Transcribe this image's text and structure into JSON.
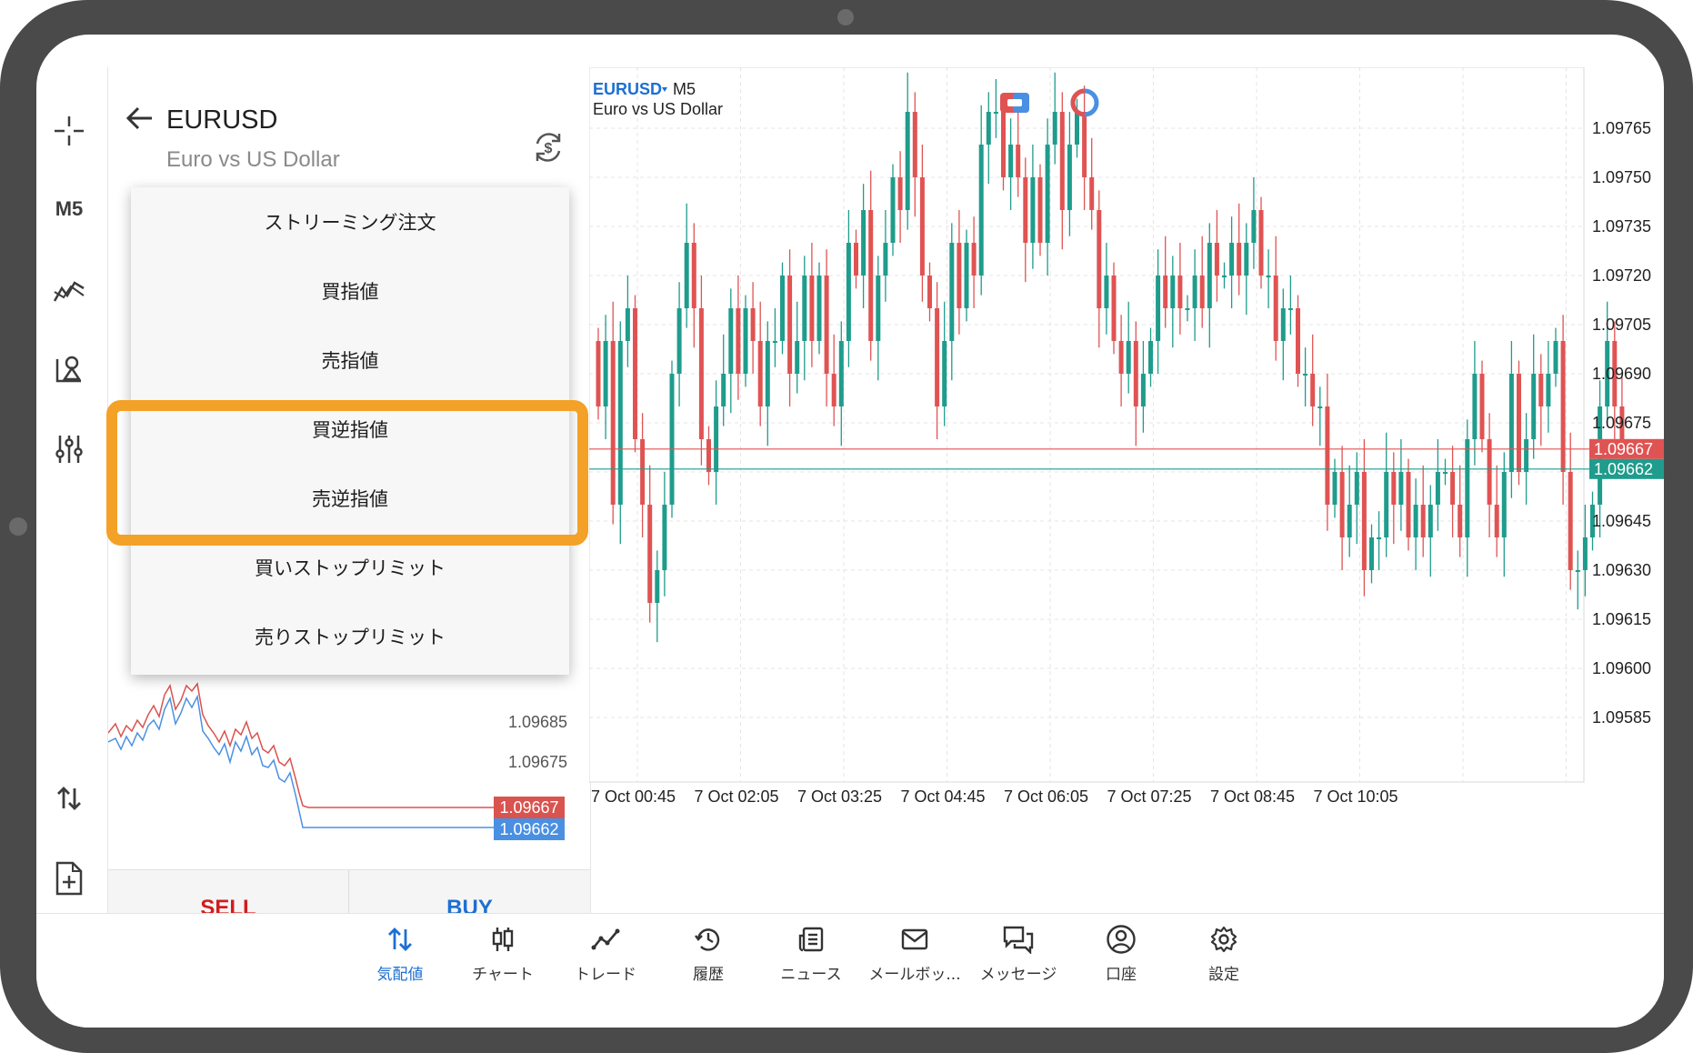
{
  "quote": {
    "symbol": "EURUSD",
    "description": "Euro vs US Dollar"
  },
  "leftbar": {
    "timeframe": "M5"
  },
  "order_menu": {
    "items": [
      "ストリーミング注文",
      "買指値",
      "売指値",
      "買逆指値",
      "売逆指値",
      "買いストップリミット",
      "売りストップリミット"
    ]
  },
  "mini_chart": {
    "visible_prices": [
      "1.09685",
      "1.09675"
    ],
    "ask_badge": "1.09667",
    "bid_badge": "1.09662"
  },
  "trade": {
    "sell_label": "SELL",
    "buy_label": "BUY"
  },
  "chart": {
    "symbol": "EURUSD",
    "timeframe": "M5",
    "description": "Euro vs US Dollar",
    "price_labels": [
      "1.09765",
      "1.09750",
      "1.09735",
      "1.09720",
      "1.09705",
      "1.09690",
      "1.09675",
      "1.09660",
      "1.09645",
      "1.09630",
      "1.09615",
      "1.09600",
      "1.09585"
    ],
    "ask_price": "1.09667",
    "bid_price": "1.09662",
    "time_labels": [
      "7 Oct 00:45",
      "7 Oct 02:05",
      "7 Oct 03:25",
      "7 Oct 04:45",
      "7 Oct 06:05",
      "7 Oct 07:25",
      "7 Oct 08:45",
      "7 Oct 10:05"
    ],
    "up_color": "#1f9c8c",
    "down_color": "#e05353"
  },
  "bottom_nav": {
    "items": [
      {
        "label": "気配値",
        "icon": "quotes-icon"
      },
      {
        "label": "チャート",
        "icon": "chart-icon"
      },
      {
        "label": "トレード",
        "icon": "trade-icon"
      },
      {
        "label": "履歴",
        "icon": "history-icon"
      },
      {
        "label": "ニュース",
        "icon": "news-icon"
      },
      {
        "label": "メールボッ...",
        "icon": "mail-icon"
      },
      {
        "label": "メッセージ",
        "icon": "messages-icon"
      },
      {
        "label": "口座",
        "icon": "account-icon"
      },
      {
        "label": "設定",
        "icon": "settings-icon"
      }
    ]
  }
}
